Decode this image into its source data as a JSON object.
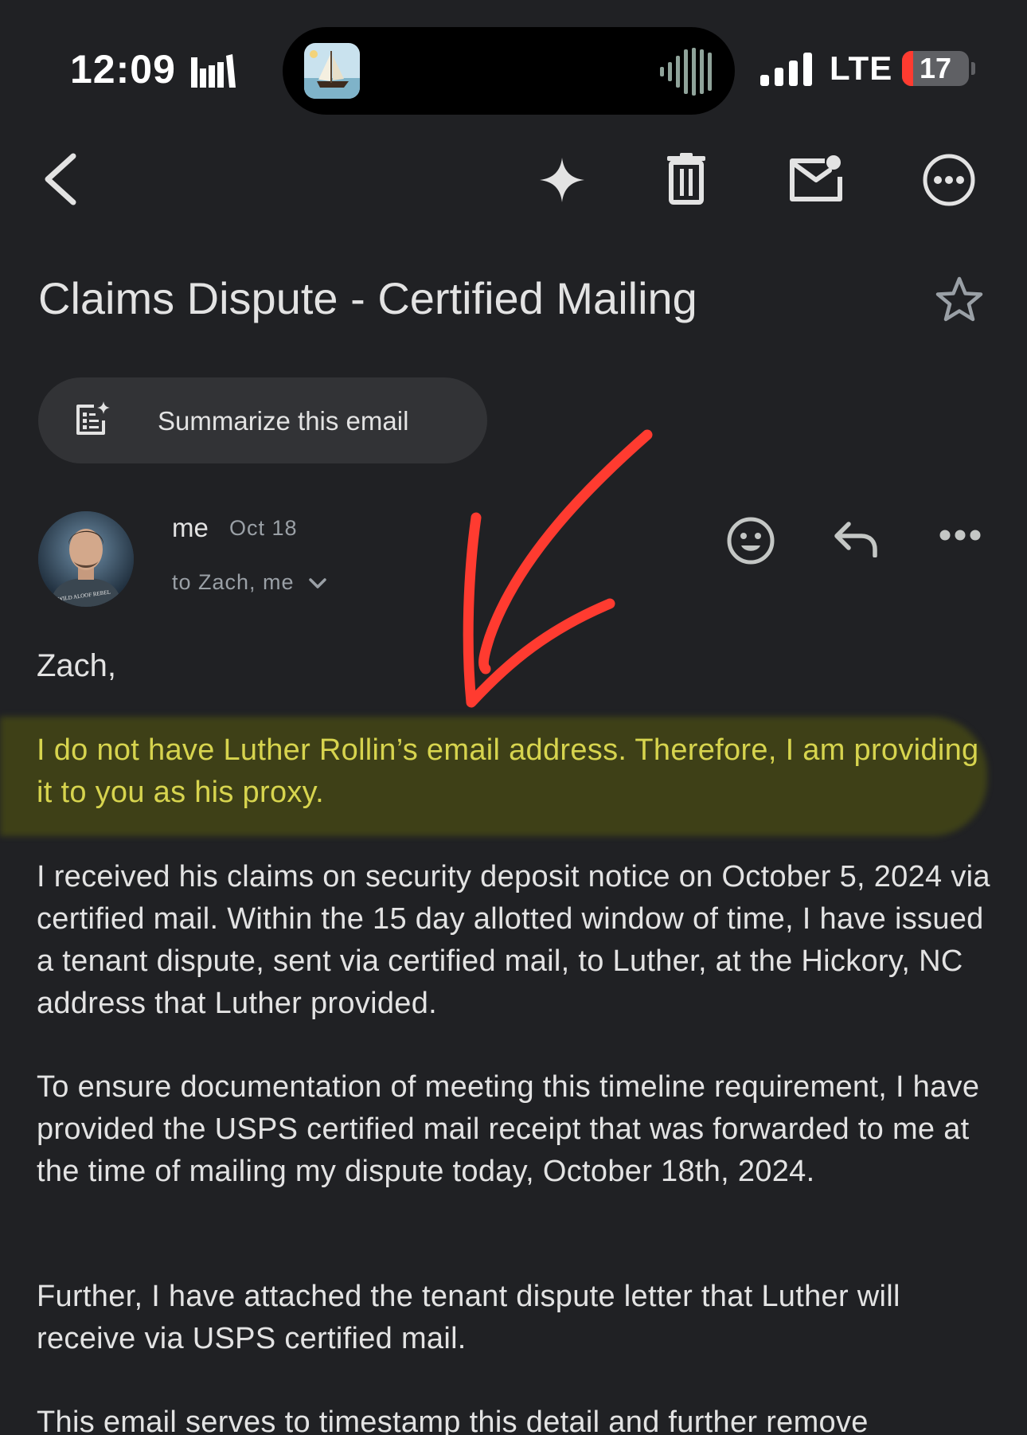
{
  "status_bar": {
    "time": "12:09",
    "network": "LTE",
    "battery": "17",
    "battery_level": 0.17,
    "icons": [
      "library-icon",
      "now-playing-artwork",
      "audio-waveform-icon",
      "signal-bars-icon",
      "battery-icon"
    ]
  },
  "toolbar": {
    "icons": [
      "back-arrow-icon",
      "gemini-sparkle-icon",
      "trash-icon",
      "mark-unread-icon",
      "more-options-icon"
    ]
  },
  "email": {
    "subject": "Claims Dispute - Certified Mailing",
    "summarize_label": "Summarize this email",
    "sender": "me",
    "date": "Oct 18",
    "recipients": "to Zach, me",
    "greeting": "Zach,",
    "highlighted_paragraph": "I do not have Luther Rollin’s email address. Therefore, I am providing it to you as his proxy.",
    "paragraphs": [
      "I received his claims on security deposit notice on October 5, 2024 via certified mail. Within the 15 day allotted window of time, I have issued a tenant dispute, sent via certified mail, to Luther, at the Hickory, NC address that Luther provided.",
      "To ensure documentation of meeting this timeline requirement, I have provided the USPS certified mail receipt that was forwarded to me at the time of mailing my dispute today, October 18th, 2024.",
      "Further, I have attached the tenant dispute letter that Luther will receive via USPS certified mail.",
      "This email serves to timestamp this detail and further remove"
    ],
    "avatar_shirt_text": "WILD ALOOF REBEL"
  },
  "colors": {
    "background": "#202124",
    "text": "#e3e3e3",
    "muted_text": "#9aa0a6",
    "chip_background": "#323336",
    "highlight_text": "#d7d44e",
    "annotation_red": "#ff3b30",
    "battery_red": "#ff3b30"
  }
}
